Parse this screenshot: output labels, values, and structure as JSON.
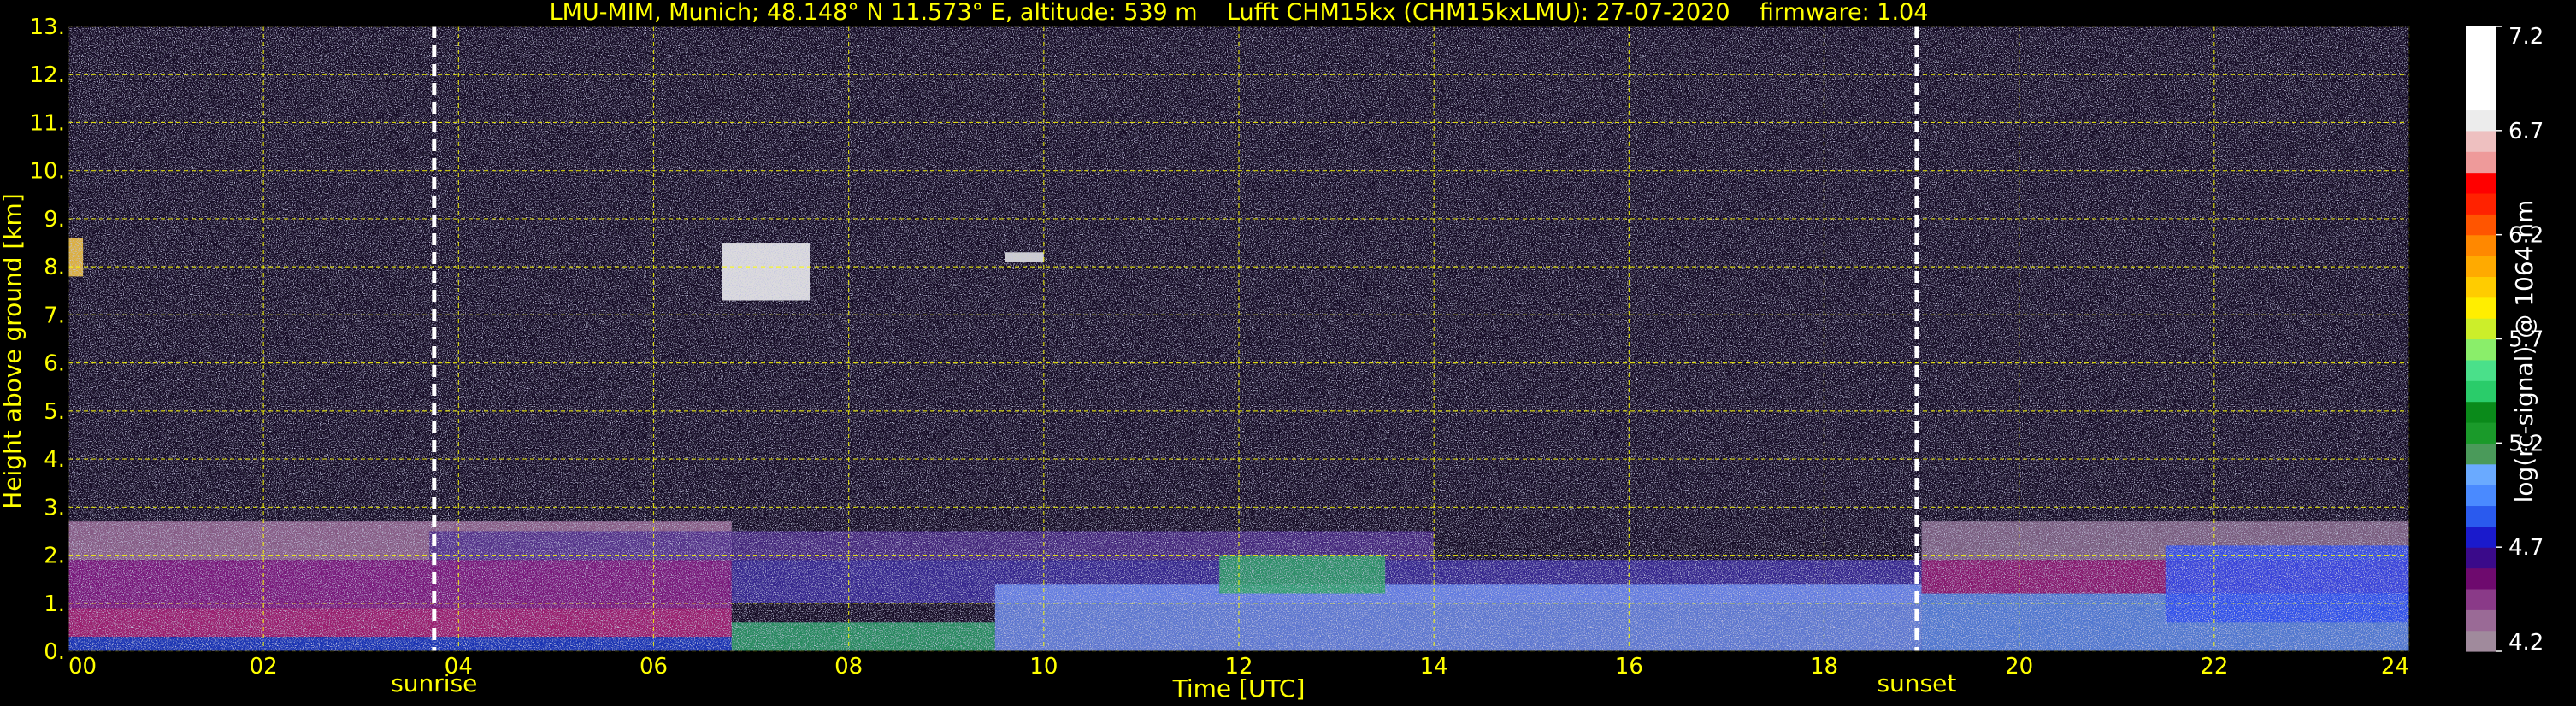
{
  "chart_data": {
    "type": "heatmap",
    "title": "LMU-MIM, Munich; 48.148° N 11.573° E, altitude: 539 m    Lufft CHM15kx (CHM15kxLMU): 27-07-2020    firmware: 1.04",
    "xlabel": "Time [UTC]",
    "ylabel": "Height above ground [km]",
    "xlim": [
      0,
      24
    ],
    "ylim": [
      0,
      13
    ],
    "xticks": [
      0,
      2,
      4,
      6,
      8,
      10,
      12,
      14,
      16,
      18,
      20,
      22,
      24
    ],
    "xtick_labels": [
      "00",
      "02",
      "04",
      "06",
      "08",
      "10",
      "12",
      "14",
      "16",
      "18",
      "20",
      "22",
      "24"
    ],
    "yticks": [
      0,
      1,
      2,
      3,
      4,
      5,
      6,
      7,
      8,
      9,
      10,
      11,
      12,
      13
    ],
    "ytick_labels": [
      "0.",
      "1.",
      "2.",
      "3.",
      "4.",
      "5.",
      "6.",
      "7.",
      "8.",
      "9.",
      "10.",
      "11.",
      "12.",
      "13."
    ],
    "grid": true,
    "grid_color": "#ffff00",
    "background_color": "#000000",
    "text_color": "#ffff00",
    "events": [
      {
        "label": "sunrise",
        "time": 3.75
      },
      {
        "label": "sunset",
        "time": 18.95
      }
    ],
    "colorbar": {
      "label": "log(rc-signal) @ 1064 nm",
      "range": [
        4.2,
        7.2
      ],
      "ticks": [
        4.2,
        4.7,
        5.2,
        5.7,
        6.2,
        6.7,
        7.2
      ],
      "tick_labels": [
        "4.2",
        "4.7",
        "5.2",
        "5.7",
        "6.2",
        "6.7",
        "7.2"
      ],
      "colors": [
        "#a08a9c",
        "#9a6a96",
        "#8a3a88",
        "#6e0a6e",
        "#3a0a8a",
        "#1a1acc",
        "#2a5aee",
        "#4a8aff",
        "#6aaaff",
        "#4a9a5a",
        "#1a9a2a",
        "#0a8a1a",
        "#2acc6a",
        "#4ae08a",
        "#8aee6a",
        "#ccee2a",
        "#ffee00",
        "#ffcc00",
        "#ffaa00",
        "#ff8800",
        "#ff5500",
        "#ff2200",
        "#ff0000",
        "#ee9a9a",
        "#eec0c0",
        "#ececec",
        "#ffffff",
        "#ffffff",
        "#ffffff",
        "#ffffff"
      ]
    },
    "layers": [
      {
        "t0": 0,
        "t1": 6.8,
        "h0": 1.9,
        "h1": 2.7,
        "color": "#9a6a96"
      },
      {
        "t0": 0,
        "t1": 6.8,
        "h0": 0.9,
        "h1": 1.9,
        "color": "#8a1a8a"
      },
      {
        "t0": 0,
        "t1": 6.8,
        "h0": 0.3,
        "h1": 0.9,
        "color": "#b0207a"
      },
      {
        "t0": 0,
        "t1": 6.8,
        "h0": 0.0,
        "h1": 0.3,
        "color": "#1a3acc"
      },
      {
        "t0": 3.7,
        "t1": 14.0,
        "h0": 1.9,
        "h1": 2.5,
        "color": "#4a2a8a"
      },
      {
        "t0": 6.8,
        "t1": 19.0,
        "h0": 1.0,
        "h1": 1.9,
        "color": "#3a2aa0"
      },
      {
        "t0": 6.8,
        "t1": 9.5,
        "h0": 0.0,
        "h1": 0.6,
        "color": "#2aa06a"
      },
      {
        "t0": 9.5,
        "t1": 19.0,
        "h0": 0.0,
        "h1": 1.4,
        "color": "#6a8aee"
      },
      {
        "t0": 11.8,
        "t1": 13.5,
        "h0": 1.2,
        "h1": 2.0,
        "color": "#2aa060"
      },
      {
        "t0": 19.0,
        "t1": 24,
        "h0": 1.9,
        "h1": 2.7,
        "color": "#8a6a8e"
      },
      {
        "t0": 19.0,
        "t1": 24,
        "h0": 1.2,
        "h1": 1.9,
        "color": "#9a1a7a"
      },
      {
        "t0": 19.0,
        "t1": 24,
        "h0": 0.0,
        "h1": 1.2,
        "color": "#5a8aee"
      },
      {
        "t0": 21.5,
        "t1": 24,
        "h0": 0.6,
        "h1": 2.2,
        "color": "#2a4aee"
      },
      {
        "t0": 6.7,
        "t1": 7.6,
        "h0": 7.3,
        "h1": 8.5,
        "color": "#ffffff"
      },
      {
        "t0": 9.6,
        "t1": 10.0,
        "h0": 8.1,
        "h1": 8.3,
        "color": "#eeeeee"
      },
      {
        "t0": 0.0,
        "t1": 0.15,
        "h0": 7.8,
        "h1": 8.6,
        "color": "#ffcc44"
      }
    ]
  }
}
